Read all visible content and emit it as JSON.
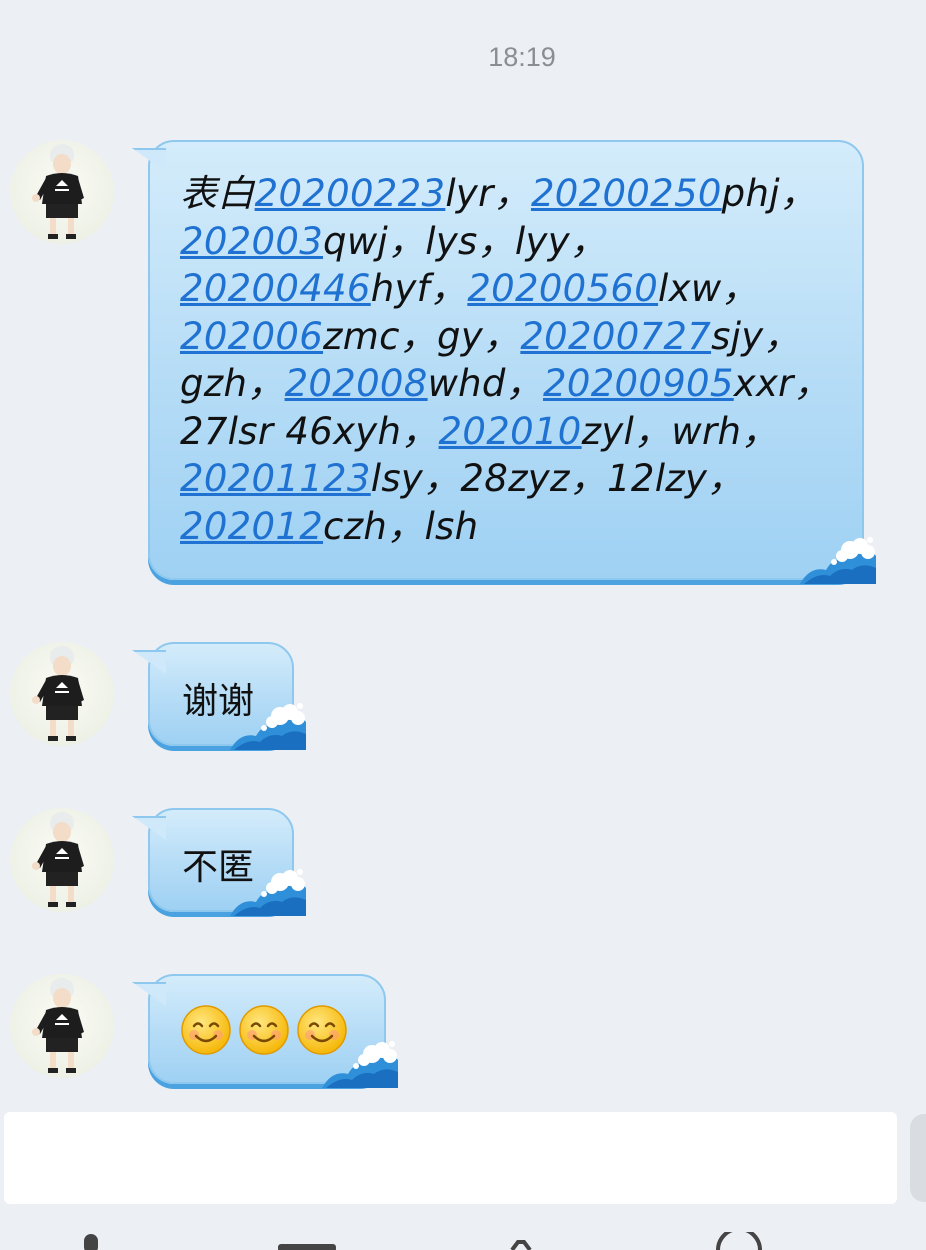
{
  "header": {
    "time": "18:19"
  },
  "messages": [
    {
      "lines": [
        [
          {
            "t": "表白"
          },
          {
            "t": "20200223",
            "link": true
          },
          {
            "t": "lyr，"
          },
          {
            "t": "20200250",
            "link": true
          },
          {
            "t": "phj，"
          }
        ],
        [
          {
            "t": "202003",
            "link": true
          },
          {
            "t": "qwj，lys，lyy，"
          }
        ],
        [
          {
            "t": "20200446",
            "link": true
          },
          {
            "t": "hyf，"
          },
          {
            "t": "20200560",
            "link": true
          },
          {
            "t": "lxw，"
          }
        ],
        [
          {
            "t": "202006",
            "link": true
          },
          {
            "t": "zmc，gy，"
          },
          {
            "t": "20200727",
            "link": true
          },
          {
            "t": "sjy，"
          }
        ],
        [
          {
            "t": "gzh，"
          },
          {
            "t": "202008",
            "link": true
          },
          {
            "t": "whd，"
          },
          {
            "t": "20200905",
            "link": true
          },
          {
            "t": "xxr，"
          }
        ],
        [
          {
            "t": "27lsr 46xyh，"
          },
          {
            "t": "202010",
            "link": true
          },
          {
            "t": "zyl，wrh，"
          }
        ],
        [
          {
            "t": "20201123",
            "link": true
          },
          {
            "t": "lsy，28zyz，12lzy，"
          }
        ],
        [
          {
            "t": "202012",
            "link": true
          },
          {
            "t": "czh，lsh"
          }
        ]
      ]
    },
    {
      "text": "谢谢"
    },
    {
      "text": "不匿"
    },
    {
      "emoji": [
        "smiling-face",
        "smiling-face",
        "smiling-face"
      ]
    }
  ],
  "colors": {
    "link": "#1f72d1",
    "bubble": "#b5dcf6",
    "background": "#eceff4"
  }
}
